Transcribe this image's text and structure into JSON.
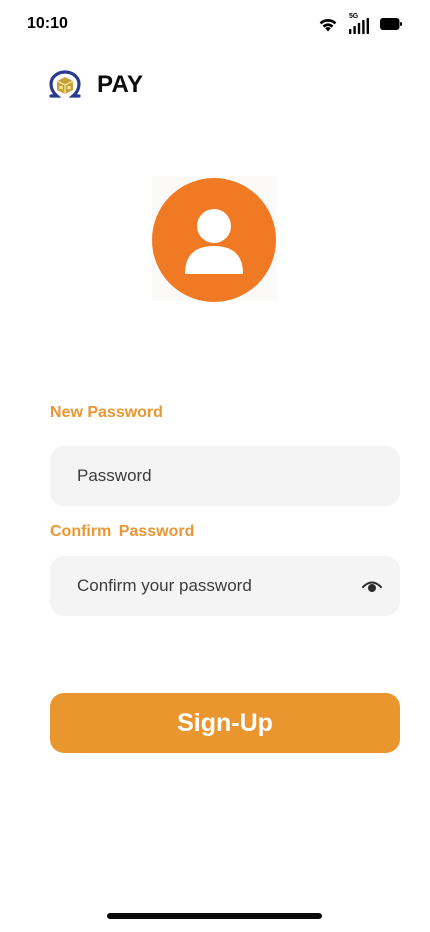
{
  "status_bar": {
    "time": "10:10",
    "network": "5G",
    "icons": [
      "wifi-icon",
      "signal-icon",
      "battery-icon"
    ]
  },
  "logo": {
    "text": "PAY",
    "icon": "omega-box-logo-icon",
    "colors": {
      "arc": "#2a3a8c",
      "box": "#c7a23a"
    }
  },
  "avatar": {
    "icon": "user-icon",
    "color": "#f07a24"
  },
  "form": {
    "new_password": {
      "label": "New Password",
      "placeholder": "Password"
    },
    "confirm_password": {
      "label": "Confirm  Password",
      "placeholder": "Confirm your password",
      "toggle_icon": "eye-icon"
    }
  },
  "signup_button": {
    "label": "Sign-Up"
  },
  "colors": {
    "accent": "#e99633",
    "button": "#e9962e",
    "input_bg": "#f4f4f4"
  }
}
